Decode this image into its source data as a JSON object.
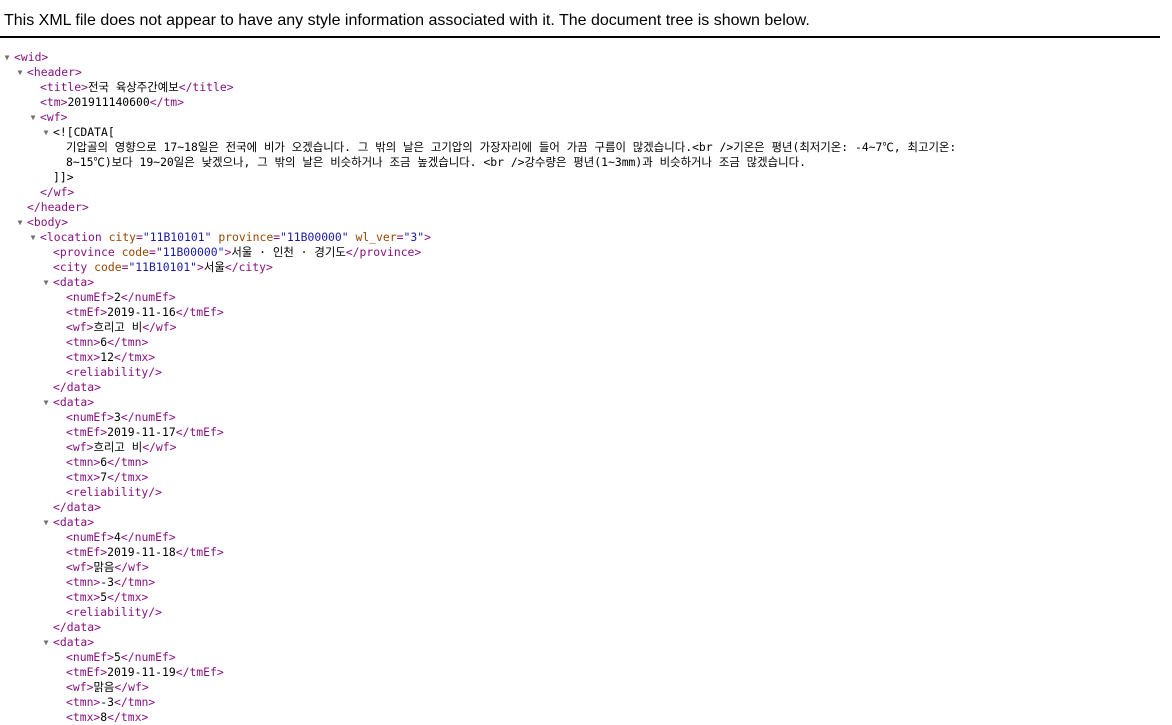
{
  "banner": {
    "message": "This XML file does not appear to have any style information associated with it. The document tree is shown below."
  },
  "colors": {
    "tag": "#881280",
    "attr_name": "#994500",
    "attr_value": "#1a1aa6",
    "toggle": "#707070"
  },
  "toggle_icon": "triangle-down-icon",
  "tree": [
    {
      "depth": 0,
      "toggle": true,
      "parts": [
        [
          "tag",
          "<wid>"
        ]
      ]
    },
    {
      "depth": 1,
      "toggle": true,
      "parts": [
        [
          "tag",
          "<header>"
        ]
      ]
    },
    {
      "depth": 2,
      "toggle": false,
      "parts": [
        [
          "tag",
          "<title>"
        ],
        [
          "txt",
          "전국 육상주간예보"
        ],
        [
          "tag",
          "</title>"
        ]
      ]
    },
    {
      "depth": 2,
      "toggle": false,
      "parts": [
        [
          "tag",
          "<tm>"
        ],
        [
          "txt",
          "201911140600"
        ],
        [
          "tag",
          "</tm>"
        ]
      ]
    },
    {
      "depth": 2,
      "toggle": true,
      "parts": [
        [
          "tag",
          "<wf>"
        ]
      ]
    },
    {
      "depth": 3,
      "toggle": true,
      "parts": [
        [
          "txt",
          "<![CDATA["
        ]
      ]
    },
    {
      "depth": 4,
      "toggle": false,
      "parts": [
        [
          "txt",
          "기압골의 영향으로 17~18일은 전국에 비가 오겠습니다. 그 밖의 날은 고기압의 가장자리에 들어 가끔 구름이 많겠습니다.<br />기온은 평년(최저기온: -4~7℃, 최고기온:"
        ]
      ]
    },
    {
      "depth": 4,
      "toggle": false,
      "parts": [
        [
          "txt",
          "8~15℃)보다 19~20일은 낮겠으나, 그 밖의 날은 비슷하거나 조금 높겠습니다. <br />강수량은 평년(1~3mm)과 비슷하거나 조금 많겠습니다."
        ]
      ]
    },
    {
      "depth": 3,
      "toggle": false,
      "parts": [
        [
          "txt",
          "]]>"
        ]
      ]
    },
    {
      "depth": 2,
      "toggle": false,
      "parts": [
        [
          "tag",
          "</wf>"
        ]
      ]
    },
    {
      "depth": 1,
      "toggle": false,
      "parts": [
        [
          "tag",
          "</header>"
        ]
      ]
    },
    {
      "depth": 1,
      "toggle": true,
      "parts": [
        [
          "tag",
          "<body>"
        ]
      ]
    },
    {
      "depth": 2,
      "toggle": true,
      "parts": [
        [
          "tag",
          "<location "
        ],
        [
          "attr-name",
          "city"
        ],
        [
          "tag",
          "="
        ],
        [
          "attr-val",
          "\"11B10101\""
        ],
        [
          "tag",
          " "
        ],
        [
          "attr-name",
          "province"
        ],
        [
          "tag",
          "="
        ],
        [
          "attr-val",
          "\"11B00000\""
        ],
        [
          "tag",
          " "
        ],
        [
          "attr-name",
          "wl_ver"
        ],
        [
          "tag",
          "="
        ],
        [
          "attr-val",
          "\"3\""
        ],
        [
          "tag",
          ">"
        ]
      ]
    },
    {
      "depth": 3,
      "toggle": false,
      "parts": [
        [
          "tag",
          "<province "
        ],
        [
          "attr-name",
          "code"
        ],
        [
          "tag",
          "="
        ],
        [
          "attr-val",
          "\"11B00000\""
        ],
        [
          "tag",
          ">"
        ],
        [
          "txt",
          "서울 · 인천 · 경기도"
        ],
        [
          "tag",
          "</province>"
        ]
      ]
    },
    {
      "depth": 3,
      "toggle": false,
      "parts": [
        [
          "tag",
          "<city "
        ],
        [
          "attr-name",
          "code"
        ],
        [
          "tag",
          "="
        ],
        [
          "attr-val",
          "\"11B10101\""
        ],
        [
          "tag",
          ">"
        ],
        [
          "txt",
          "서울"
        ],
        [
          "tag",
          "</city>"
        ]
      ]
    },
    {
      "depth": 3,
      "toggle": true,
      "parts": [
        [
          "tag",
          "<data>"
        ]
      ]
    },
    {
      "depth": 4,
      "toggle": false,
      "parts": [
        [
          "tag",
          "<numEf>"
        ],
        [
          "txt",
          "2"
        ],
        [
          "tag",
          "</numEf>"
        ]
      ]
    },
    {
      "depth": 4,
      "toggle": false,
      "parts": [
        [
          "tag",
          "<tmEf>"
        ],
        [
          "txt",
          "2019-11-16"
        ],
        [
          "tag",
          "</tmEf>"
        ]
      ]
    },
    {
      "depth": 4,
      "toggle": false,
      "parts": [
        [
          "tag",
          "<wf>"
        ],
        [
          "txt",
          "흐리고 비"
        ],
        [
          "tag",
          "</wf>"
        ]
      ]
    },
    {
      "depth": 4,
      "toggle": false,
      "parts": [
        [
          "tag",
          "<tmn>"
        ],
        [
          "txt",
          "6"
        ],
        [
          "tag",
          "</tmn>"
        ]
      ]
    },
    {
      "depth": 4,
      "toggle": false,
      "parts": [
        [
          "tag",
          "<tmx>"
        ],
        [
          "txt",
          "12"
        ],
        [
          "tag",
          "</tmx>"
        ]
      ]
    },
    {
      "depth": 4,
      "toggle": false,
      "parts": [
        [
          "tag",
          "<reliability/>"
        ]
      ]
    },
    {
      "depth": 3,
      "toggle": false,
      "parts": [
        [
          "tag",
          "</data>"
        ]
      ]
    },
    {
      "depth": 3,
      "toggle": true,
      "parts": [
        [
          "tag",
          "<data>"
        ]
      ]
    },
    {
      "depth": 4,
      "toggle": false,
      "parts": [
        [
          "tag",
          "<numEf>"
        ],
        [
          "txt",
          "3"
        ],
        [
          "tag",
          "</numEf>"
        ]
      ]
    },
    {
      "depth": 4,
      "toggle": false,
      "parts": [
        [
          "tag",
          "<tmEf>"
        ],
        [
          "txt",
          "2019-11-17"
        ],
        [
          "tag",
          "</tmEf>"
        ]
      ]
    },
    {
      "depth": 4,
      "toggle": false,
      "parts": [
        [
          "tag",
          "<wf>"
        ],
        [
          "txt",
          "흐리고 비"
        ],
        [
          "tag",
          "</wf>"
        ]
      ]
    },
    {
      "depth": 4,
      "toggle": false,
      "parts": [
        [
          "tag",
          "<tmn>"
        ],
        [
          "txt",
          "6"
        ],
        [
          "tag",
          "</tmn>"
        ]
      ]
    },
    {
      "depth": 4,
      "toggle": false,
      "parts": [
        [
          "tag",
          "<tmx>"
        ],
        [
          "txt",
          "7"
        ],
        [
          "tag",
          "</tmx>"
        ]
      ]
    },
    {
      "depth": 4,
      "toggle": false,
      "parts": [
        [
          "tag",
          "<reliability/>"
        ]
      ]
    },
    {
      "depth": 3,
      "toggle": false,
      "parts": [
        [
          "tag",
          "</data>"
        ]
      ]
    },
    {
      "depth": 3,
      "toggle": true,
      "parts": [
        [
          "tag",
          "<data>"
        ]
      ]
    },
    {
      "depth": 4,
      "toggle": false,
      "parts": [
        [
          "tag",
          "<numEf>"
        ],
        [
          "txt",
          "4"
        ],
        [
          "tag",
          "</numEf>"
        ]
      ]
    },
    {
      "depth": 4,
      "toggle": false,
      "parts": [
        [
          "tag",
          "<tmEf>"
        ],
        [
          "txt",
          "2019-11-18"
        ],
        [
          "tag",
          "</tmEf>"
        ]
      ]
    },
    {
      "depth": 4,
      "toggle": false,
      "parts": [
        [
          "tag",
          "<wf>"
        ],
        [
          "txt",
          "맑음"
        ],
        [
          "tag",
          "</wf>"
        ]
      ]
    },
    {
      "depth": 4,
      "toggle": false,
      "parts": [
        [
          "tag",
          "<tmn>"
        ],
        [
          "txt",
          "-3"
        ],
        [
          "tag",
          "</tmn>"
        ]
      ]
    },
    {
      "depth": 4,
      "toggle": false,
      "parts": [
        [
          "tag",
          "<tmx>"
        ],
        [
          "txt",
          "5"
        ],
        [
          "tag",
          "</tmx>"
        ]
      ]
    },
    {
      "depth": 4,
      "toggle": false,
      "parts": [
        [
          "tag",
          "<reliability/>"
        ]
      ]
    },
    {
      "depth": 3,
      "toggle": false,
      "parts": [
        [
          "tag",
          "</data>"
        ]
      ]
    },
    {
      "depth": 3,
      "toggle": true,
      "parts": [
        [
          "tag",
          "<data>"
        ]
      ]
    },
    {
      "depth": 4,
      "toggle": false,
      "parts": [
        [
          "tag",
          "<numEf>"
        ],
        [
          "txt",
          "5"
        ],
        [
          "tag",
          "</numEf>"
        ]
      ]
    },
    {
      "depth": 4,
      "toggle": false,
      "parts": [
        [
          "tag",
          "<tmEf>"
        ],
        [
          "txt",
          "2019-11-19"
        ],
        [
          "tag",
          "</tmEf>"
        ]
      ]
    },
    {
      "depth": 4,
      "toggle": false,
      "parts": [
        [
          "tag",
          "<wf>"
        ],
        [
          "txt",
          "맑음"
        ],
        [
          "tag",
          "</wf>"
        ]
      ]
    },
    {
      "depth": 4,
      "toggle": false,
      "parts": [
        [
          "tag",
          "<tmn>"
        ],
        [
          "txt",
          "-3"
        ],
        [
          "tag",
          "</tmn>"
        ]
      ]
    },
    {
      "depth": 4,
      "toggle": false,
      "parts": [
        [
          "tag",
          "<tmx>"
        ],
        [
          "txt",
          "8"
        ],
        [
          "tag",
          "</tmx>"
        ]
      ]
    }
  ]
}
